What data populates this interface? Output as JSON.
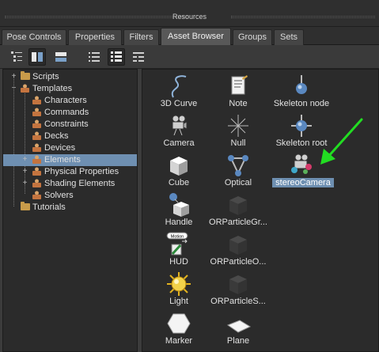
{
  "window": {
    "title": "Resources"
  },
  "tabs": [
    {
      "label": "Pose Controls"
    },
    {
      "label": "Properties"
    },
    {
      "label": "Filters"
    },
    {
      "label": "Asset Browser"
    },
    {
      "label": "Groups"
    },
    {
      "label": "Sets"
    }
  ],
  "active_tab": "Asset Browser",
  "toolbar": {
    "buttons": [
      "tree-view-icon",
      "split-vertical-icon",
      "split-horizontal-icon",
      "list-view-icon",
      "icon-view-icon",
      "detail-view-icon"
    ]
  },
  "tree": {
    "items": [
      {
        "label": "Scripts"
      },
      {
        "label": "Templates"
      },
      {
        "label": "Characters"
      },
      {
        "label": "Commands"
      },
      {
        "label": "Constraints"
      },
      {
        "label": "Decks"
      },
      {
        "label": "Devices"
      },
      {
        "label": "Elements"
      },
      {
        "label": "Physical Properties"
      },
      {
        "label": "Shading Elements"
      },
      {
        "label": "Solvers"
      },
      {
        "label": "Tutorials"
      }
    ],
    "selected": "Elements"
  },
  "assets": [
    {
      "label": "3D Curve"
    },
    {
      "label": "Note"
    },
    {
      "label": "Skeleton node"
    },
    {
      "label": "Camera"
    },
    {
      "label": "Null"
    },
    {
      "label": "Skeleton root"
    },
    {
      "label": "Cube"
    },
    {
      "label": "Optical"
    },
    {
      "label": "stereoCamera"
    },
    {
      "label": "Handle"
    },
    {
      "label": "ORParticleGr..."
    },
    {
      "label": "HUD"
    },
    {
      "label": "ORParticleO..."
    },
    {
      "label": "Light"
    },
    {
      "label": "ORParticleS..."
    },
    {
      "label": "Marker"
    },
    {
      "label": "Plane"
    }
  ],
  "selected_asset": "stereoCamera",
  "hud_icon_text": "Motion",
  "colors": {
    "selection": "#6e8fb1",
    "arrow": "#22dd22",
    "folder": "#c89b4a"
  }
}
